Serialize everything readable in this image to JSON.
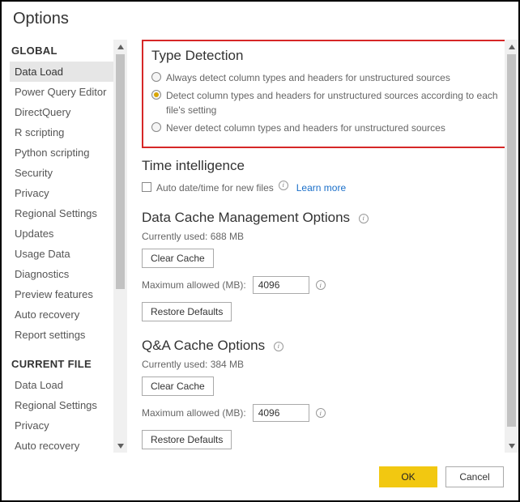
{
  "title": "Options",
  "sidebar": {
    "global_header": "GLOBAL",
    "current_file_header": "CURRENT FILE",
    "global": [
      {
        "label": "Data Load",
        "selected": true
      },
      {
        "label": "Power Query Editor"
      },
      {
        "label": "DirectQuery"
      },
      {
        "label": "R scripting"
      },
      {
        "label": "Python scripting"
      },
      {
        "label": "Security"
      },
      {
        "label": "Privacy"
      },
      {
        "label": "Regional Settings"
      },
      {
        "label": "Updates"
      },
      {
        "label": "Usage Data"
      },
      {
        "label": "Diagnostics"
      },
      {
        "label": "Preview features"
      },
      {
        "label": "Auto recovery"
      },
      {
        "label": "Report settings"
      }
    ],
    "current_file": [
      {
        "label": "Data Load"
      },
      {
        "label": "Regional Settings"
      },
      {
        "label": "Privacy"
      },
      {
        "label": "Auto recovery"
      }
    ]
  },
  "type_detection": {
    "heading": "Type Detection",
    "options": [
      "Always detect column types and headers for unstructured sources",
      "Detect column types and headers for unstructured sources according to each file's setting",
      "Never detect column types and headers for unstructured sources"
    ],
    "selected_index": 1
  },
  "time_intel": {
    "heading": "Time intelligence",
    "checkbox_label": "Auto date/time for new files",
    "learn_more": "Learn more"
  },
  "data_cache": {
    "heading": "Data Cache Management Options",
    "currently_used_label": "Currently used: 688 MB",
    "clear_btn": "Clear Cache",
    "max_label": "Maximum allowed (MB):",
    "max_value": "4096",
    "restore_btn": "Restore Defaults"
  },
  "qa_cache": {
    "heading": "Q&A Cache Options",
    "currently_used_label": "Currently used: 384 MB",
    "clear_btn": "Clear Cache",
    "max_label": "Maximum allowed (MB):",
    "max_value": "4096",
    "restore_btn": "Restore Defaults"
  },
  "footer": {
    "ok": "OK",
    "cancel": "Cancel"
  }
}
